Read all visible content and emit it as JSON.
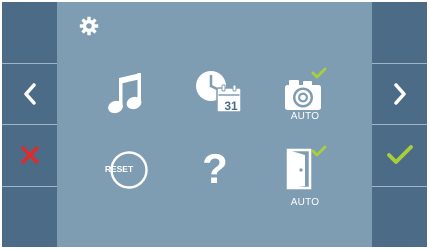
{
  "colors": {
    "screen_bg": "#7f9db2",
    "side_bg": "#4b6b86",
    "icon_white": "#ffffff",
    "cancel_red": "#e02b2b",
    "confirm_green": "#a8cf3a"
  },
  "header": {
    "settings_icon": "gear-icon"
  },
  "nav": {
    "left_arrow_icon": "chevron-left-icon",
    "right_arrow_icon": "chevron-right-icon",
    "cancel_icon": "cross-icon",
    "confirm_icon": "checkmark-icon"
  },
  "menu": {
    "items": [
      {
        "icon": "music-note-icon"
      },
      {
        "icon": "clock-calendar-icon",
        "calendar_day": "31"
      },
      {
        "icon": "camera-icon",
        "label": "AUTO",
        "checked": true
      },
      {
        "icon": "reset-icon",
        "label": "RESET"
      },
      {
        "icon": "question-mark-icon",
        "label": "?"
      },
      {
        "icon": "door-icon",
        "label": "AUTO",
        "checked": true
      }
    ]
  }
}
